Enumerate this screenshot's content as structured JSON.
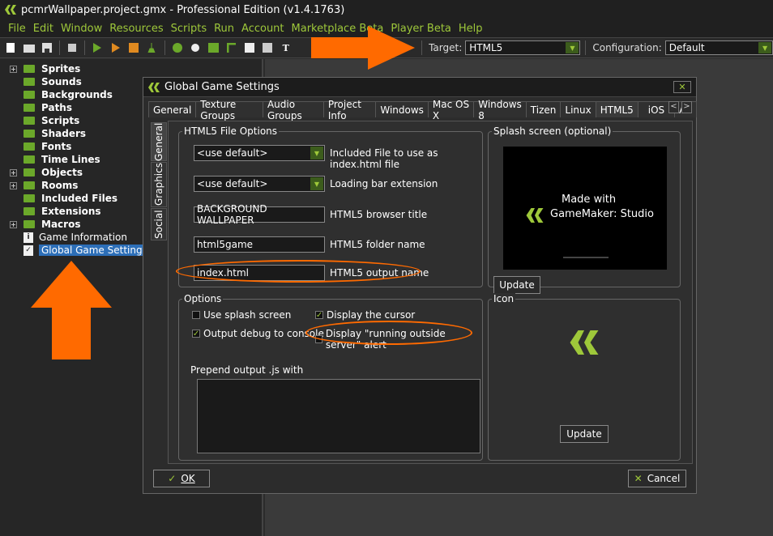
{
  "window": {
    "title": "pcmrWallpaper.project.gmx  -  Professional Edition (v1.4.1763)"
  },
  "menu": [
    "File",
    "Edit",
    "Window",
    "Resources",
    "Scripts",
    "Run",
    "Account",
    "Marketplace Beta",
    "Player Beta",
    "Help"
  ],
  "toolbar": {
    "target_label": "Target:",
    "target_value": "HTML5",
    "config_label": "Configuration:",
    "config_value": "Default"
  },
  "tree": {
    "items": [
      {
        "label": "Sprites",
        "expandable": true
      },
      {
        "label": "Sounds",
        "expandable": false
      },
      {
        "label": "Backgrounds",
        "expandable": false
      },
      {
        "label": "Paths",
        "expandable": false
      },
      {
        "label": "Scripts",
        "expandable": false
      },
      {
        "label": "Shaders",
        "expandable": false
      },
      {
        "label": "Fonts",
        "expandable": false
      },
      {
        "label": "Time Lines",
        "expandable": false
      },
      {
        "label": "Objects",
        "expandable": true
      },
      {
        "label": "Rooms",
        "expandable": true
      },
      {
        "label": "Included Files",
        "expandable": false
      },
      {
        "label": "Extensions",
        "expandable": false
      },
      {
        "label": "Macros",
        "expandable": true
      }
    ],
    "game_info": "Game Information",
    "global_settings": "Global Game Settings"
  },
  "dialog": {
    "title": "Global Game Settings",
    "tabs": [
      "General",
      "Texture Groups",
      "Audio Groups",
      "Project Info",
      "Windows",
      "Mac OS X",
      "Windows 8",
      "Tizen",
      "Linux",
      "HTML5",
      "iOS",
      "An"
    ],
    "active_tab": "HTML5",
    "vtabs": [
      "General",
      "Graphics",
      "Social"
    ],
    "html5_group": "HTML5 File Options",
    "included_file_value": "<use default>",
    "included_file_label": "Included File to use as index.html file",
    "loading_bar_value": "<use default>",
    "loading_bar_label": "Loading bar extension",
    "browser_title_value": "BACKGROUND WALLPAPER",
    "browser_title_label": "HTML5 browser title",
    "folder_value": "html5game",
    "folder_label": "HTML5 folder name",
    "output_value": "index.html",
    "output_label": "HTML5 output name",
    "splash_group": "Splash screen (optional)",
    "splash_line1": "Made with",
    "splash_line2": "GameMaker: Studio",
    "update_label": "Update",
    "options_group": "Options",
    "use_splash": "Use splash screen",
    "display_cursor": "Display the cursor",
    "output_debug": "Output debug to console",
    "running_outside": "Display \"running outside server\" alert",
    "prepend_label": "Prepend output .js with",
    "icon_group": "Icon",
    "ok_label": "OK",
    "cancel_label": "Cancel"
  },
  "accent": "#9ec83a",
  "highlight": "#ff6a00"
}
